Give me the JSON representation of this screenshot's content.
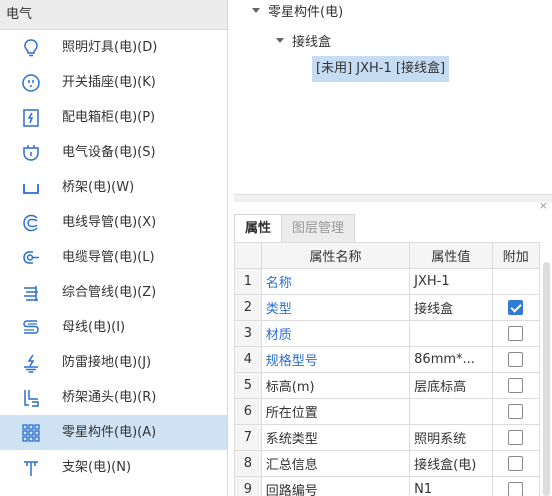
{
  "left_panel": {
    "category_header": "电气",
    "items": [
      {
        "label": "照明灯具(电)(D)",
        "icon": "lightbulb-icon"
      },
      {
        "label": "开关插座(电)(K)",
        "icon": "switch-socket-icon"
      },
      {
        "label": "配电箱柜(电)(P)",
        "icon": "distribution-box-icon"
      },
      {
        "label": "电气设备(电)(S)",
        "icon": "electrical-equipment-icon"
      },
      {
        "label": "桥架(电)(W)",
        "icon": "cable-tray-icon"
      },
      {
        "label": "电线导管(电)(X)",
        "icon": "wire-conduit-icon"
      },
      {
        "label": "电缆导管(电)(L)",
        "icon": "cable-conduit-icon"
      },
      {
        "label": "综合管线(电)(Z)",
        "icon": "combined-pipeline-icon"
      },
      {
        "label": "母线(电)(I)",
        "icon": "busbar-icon"
      },
      {
        "label": "防雷接地(电)(J)",
        "icon": "lightning-grounding-icon"
      },
      {
        "label": "桥架通头(电)(R)",
        "icon": "tray-fitting-icon"
      },
      {
        "label": "零星构件(电)(A)",
        "icon": "grid-components-icon",
        "selected": true
      },
      {
        "label": "支架(电)(N)",
        "icon": "bracket-icon"
      }
    ]
  },
  "tree": {
    "root": "零星构件(电)",
    "child": "接线盒",
    "leaf": "[未用] JXH-1 [接线盒]"
  },
  "properties": {
    "close_glyph": "×",
    "tabs": [
      {
        "label": "属性",
        "active": true
      },
      {
        "label": "图层管理",
        "active": false
      }
    ],
    "columns": [
      "",
      "属性名称",
      "属性值",
      "附加"
    ],
    "rows": [
      {
        "num": "1",
        "name": "名称",
        "value": "JXH-1",
        "blue": true,
        "checkbox": false,
        "checked": false
      },
      {
        "num": "2",
        "name": "类型",
        "value": "接线盒",
        "blue": true,
        "checkbox": true,
        "checked": true
      },
      {
        "num": "3",
        "name": "材质",
        "value": "",
        "blue": true,
        "checkbox": true,
        "checked": false
      },
      {
        "num": "4",
        "name": "规格型号",
        "value": "86mm*...",
        "blue": true,
        "checkbox": true,
        "checked": false
      },
      {
        "num": "5",
        "name": "标高(m)",
        "value": "层底标高",
        "blue": false,
        "checkbox": true,
        "checked": false
      },
      {
        "num": "6",
        "name": "所在位置",
        "value": "",
        "blue": false,
        "checkbox": true,
        "checked": false
      },
      {
        "num": "7",
        "name": "系统类型",
        "value": "照明系统",
        "blue": false,
        "checkbox": true,
        "checked": false
      },
      {
        "num": "8",
        "name": "汇总信息",
        "value": "接线盒(电)",
        "blue": false,
        "checkbox": true,
        "checked": false
      },
      {
        "num": "9",
        "name": "回路编号",
        "value": "N1",
        "blue": false,
        "checkbox": true,
        "checked": false
      }
    ]
  },
  "colors": {
    "selected_bg": "#d0e3f5",
    "tree_leaf_bg": "#c6dcf2",
    "icon_blue": "#2b6fcf",
    "checkbox_blue": "#2f7bd6"
  }
}
